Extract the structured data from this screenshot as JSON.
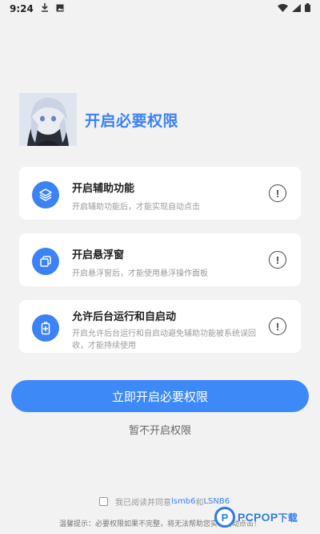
{
  "status_bar": {
    "time": "9:24",
    "icons": [
      "download-icon",
      "image-icon",
      "wifi-icon",
      "signal-icon",
      "battery-icon"
    ]
  },
  "header": {
    "title": "开启必要权限"
  },
  "permissions": [
    {
      "icon": "layers-icon",
      "title": "开启辅助功能",
      "description": "开启辅助功能后，才能实现自动点击"
    },
    {
      "icon": "window-icon",
      "title": "开启悬浮窗",
      "description": "开启悬浮窗后，才能使用悬浮操作面板"
    },
    {
      "icon": "battery-plus-icon",
      "title": "允许后台运行和自启动",
      "description": "开启允许后台运行和自启动避免辅助功能被系统误回收，才能持续使用"
    }
  ],
  "actions": {
    "primary": "立即开启必要权限",
    "secondary": "暂不开启权限"
  },
  "agreement": {
    "prefix": "我已阅读并同意",
    "link1": "lsmb6",
    "conj": "和",
    "link2": "LSNB6"
  },
  "tip": "温馨提示：必要权限如果不完整，将无法帮助您实现自动点击！",
  "watermark": {
    "logo_letter": "P",
    "text": "PCPOP",
    "suffix": "下载"
  },
  "colors": {
    "accent": "#3b82f6",
    "background": "#f2f2f2"
  }
}
